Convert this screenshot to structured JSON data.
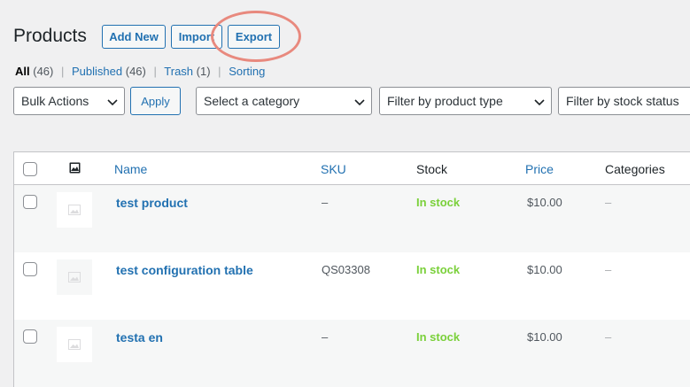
{
  "header": {
    "title": "Products",
    "add_new": "Add New",
    "import": "Import",
    "export": "Export"
  },
  "views": {
    "all": "All",
    "all_count": "(46)",
    "published": "Published",
    "published_count": "(46)",
    "trash": "Trash",
    "trash_count": "(1)",
    "sorting": "Sorting",
    "separator": "|"
  },
  "filters": {
    "bulk_actions": "Bulk Actions",
    "apply": "Apply",
    "category": "Select a category",
    "product_type": "Filter by product type",
    "stock_status": "Filter by stock status"
  },
  "table": {
    "columns": {
      "name": "Name",
      "sku": "SKU",
      "stock": "Stock",
      "price": "Price",
      "categories": "Categories"
    },
    "rows": [
      {
        "name": "test product",
        "sku": "–",
        "stock": "In stock",
        "price": "$10.00",
        "categories": "–"
      },
      {
        "name": "test configuration table",
        "sku": "QS03308",
        "stock": "In stock",
        "price": "$10.00",
        "categories": "–"
      },
      {
        "name": "testa en",
        "sku": "–",
        "stock": "In stock",
        "price": "$10.00",
        "categories": "–"
      }
    ]
  },
  "colors": {
    "link": "#2271b1",
    "in_stock": "#7ad03a",
    "highlight": "#e8897e"
  }
}
